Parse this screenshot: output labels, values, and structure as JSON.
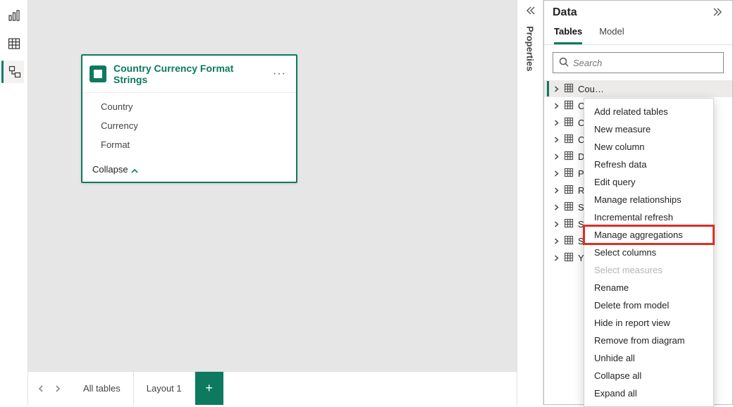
{
  "card": {
    "title": "Country Currency Format Strings",
    "fields": [
      "Country",
      "Currency",
      "Format"
    ],
    "collapse_label": "Collapse"
  },
  "tabs": {
    "items": [
      "All tables",
      "Layout 1"
    ],
    "add_label": "+"
  },
  "properties_label": "Properties",
  "data_pane": {
    "title": "Data",
    "tabs": [
      "Tables",
      "Model"
    ],
    "search_placeholder": "Search",
    "tables": [
      "Cou",
      "Cur",
      "Cur",
      "Cus",
      "Dat",
      "Pro",
      "Res",
      "Sal",
      "Sal",
      "Sal",
      "Yea"
    ]
  },
  "context_menu": {
    "items": [
      "Add related tables",
      "New measure",
      "New column",
      "Refresh data",
      "Edit query",
      "Manage relationships",
      "Incremental refresh",
      "Manage aggregations",
      "Select columns",
      "Select measures",
      "Rename",
      "Delete from model",
      "Hide in report view",
      "Remove from diagram",
      "Unhide all",
      "Collapse all",
      "Expand all"
    ],
    "disabled_index": 9,
    "highlighted_index": 7
  }
}
